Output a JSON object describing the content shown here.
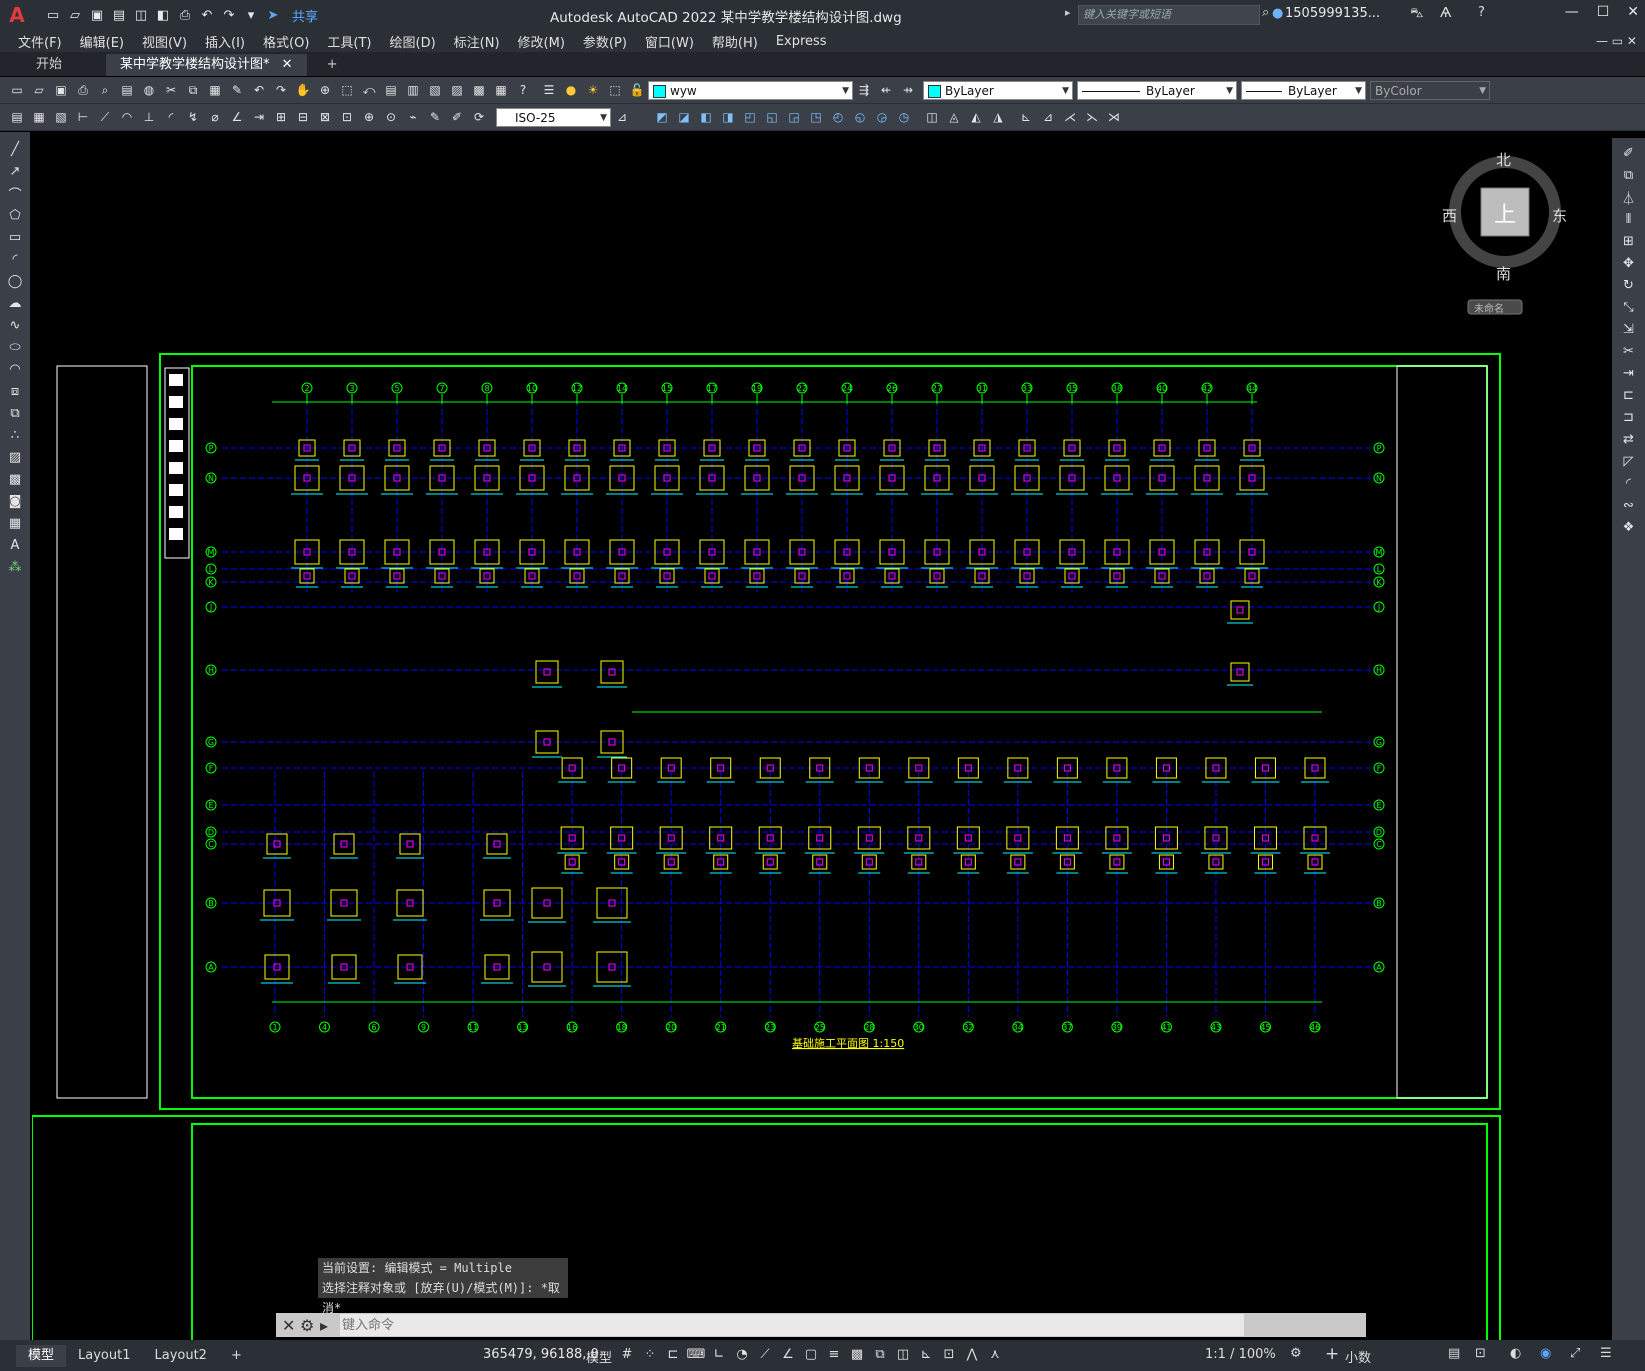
{
  "app": {
    "logo": "A",
    "title": "Autodesk AutoCAD 2022    某中学教学楼结构设计图.dwg",
    "share": "共享",
    "search_placeholder": "键入关键字或短语",
    "user": "1505999135...",
    "window_controls": {
      "minimize": "—",
      "restore": "☐",
      "close": "✕"
    }
  },
  "menu": [
    "文件(F)",
    "编辑(E)",
    "视图(V)",
    "插入(I)",
    "格式(O)",
    "工具(T)",
    "绘图(D)",
    "标注(N)",
    "修改(M)",
    "参数(P)",
    "窗口(W)",
    "帮助(H)",
    "Express"
  ],
  "tabs": {
    "start": "开始",
    "doc": "某中学教学楼结构设计图*",
    "close": "✕",
    "add": "+"
  },
  "properties": {
    "layer": "wyw",
    "color": "ByLayer",
    "linetype": "ByLayer",
    "lineweight": "ByLayer",
    "plotstyle": "ByColor",
    "dimstyle": "ISO-25",
    "layer_color": "#00ffff"
  },
  "viewcube": {
    "north": "北",
    "south": "南",
    "east": "东",
    "west": "西",
    "top": "上",
    "ucs": "未命名"
  },
  "drawing": {
    "title": "基础施工平面图  1:150",
    "top_axes": [
      "2",
      "3",
      "5",
      "7",
      "8",
      "10",
      "12",
      "14",
      "15",
      "17",
      "19",
      "22",
      "24",
      "26",
      "27",
      "31",
      "33",
      "35",
      "38",
      "40",
      "42",
      "44"
    ],
    "bottom_axes": [
      "1",
      "4",
      "6",
      "9",
      "11",
      "13",
      "16",
      "18",
      "20",
      "21",
      "23",
      "25",
      "28",
      "30",
      "32",
      "34",
      "37",
      "39",
      "41",
      "43",
      "45",
      "46"
    ],
    "row_axes_top": [
      "P",
      "N",
      "M",
      "L",
      "K",
      "J",
      "H",
      "G",
      "F",
      "E",
      "D",
      "C",
      "B",
      "A"
    ],
    "colors": {
      "frame": "#00ff00",
      "axis": "#0000ff",
      "foundation": "#ffff00",
      "pile": "#ff00ff",
      "dims": "#00ffff"
    }
  },
  "command": {
    "history": [
      "当前设置: 编辑模式 = Multiple",
      "选择注释对象或 [放弃(U)/模式(M)]: *取消*"
    ],
    "prompt_placeholder": "键入命令"
  },
  "status": {
    "layout_tabs": [
      "模型",
      "Layout1",
      "Layout2"
    ],
    "add_layout": "+",
    "coords": "365479, 96188, 0",
    "model": "模型",
    "scale": "1:1 / 100%",
    "units": "小数"
  }
}
